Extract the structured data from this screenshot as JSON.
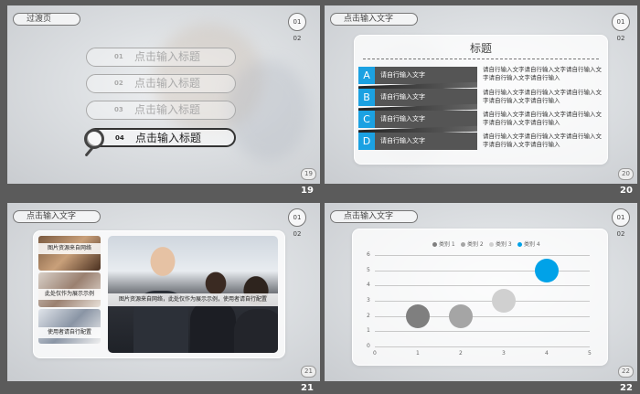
{
  "slides": [
    {
      "number": "19",
      "title": "过渡页",
      "corner": "01 02",
      "toc": [
        {
          "num": "01",
          "label": "点击输入标题",
          "active": false
        },
        {
          "num": "02",
          "label": "点击输入标题",
          "active": false
        },
        {
          "num": "03",
          "label": "点击输入标题",
          "active": false
        },
        {
          "num": "04",
          "label": "点击输入标题",
          "active": true
        }
      ]
    },
    {
      "number": "20",
      "title": "点击输入文字",
      "corner": "01 02",
      "card_heading": "标题",
      "rows": [
        {
          "letter": "A",
          "label": "请自行输入文字"
        },
        {
          "letter": "B",
          "label": "请自行输入文字"
        },
        {
          "letter": "C",
          "label": "请自行输入文字"
        },
        {
          "letter": "D",
          "label": "请自行输入文字"
        }
      ],
      "paragraphs": [
        "请自行输入文字请自行输入文字请自行输入文字请自行输入文字请自行输入",
        "请自行输入文字请自行输入文字请自行输入文字请自行输入文字请自行输入",
        "请自行输入文字请自行输入文字请自行输入文字请自行输入文字请自行输入",
        "请自行输入文字请自行输入文字请自行输入文字请自行输入文字请自行输入"
      ]
    },
    {
      "number": "21",
      "title": "点击输入文字",
      "corner": "01 02",
      "thumbs": [
        "图片资源来自网络",
        "此处仅作为展示示例",
        "使用者请自行配置"
      ],
      "photo_caption": "图片资源来自网络，此处仅作为展示示例，使用者请自行配置"
    },
    {
      "number": "22",
      "title": "点击输入文字",
      "corner": "01 02"
    }
  ],
  "chart_data": {
    "type": "scatter",
    "series": [
      {
        "name": "类别 1",
        "color": "#7f7f7f",
        "x": [
          1
        ],
        "y": [
          2
        ]
      },
      {
        "name": "类别 2",
        "color": "#a5a5a5",
        "x": [
          2
        ],
        "y": [
          2
        ]
      },
      {
        "name": "类别 3",
        "color": "#d0d0d0",
        "x": [
          3
        ],
        "y": [
          3
        ]
      },
      {
        "name": "类别 4",
        "color": "#00a2e8",
        "x": [
          4
        ],
        "y": [
          5
        ]
      }
    ],
    "xlim": [
      0,
      5
    ],
    "ylim": [
      0,
      6
    ],
    "xticks": [
      "0",
      "1",
      "2",
      "3",
      "4",
      "5"
    ],
    "yticks": [
      "0",
      "1",
      "2",
      "3",
      "4",
      "5",
      "6"
    ],
    "legend": "top",
    "grid": true
  }
}
